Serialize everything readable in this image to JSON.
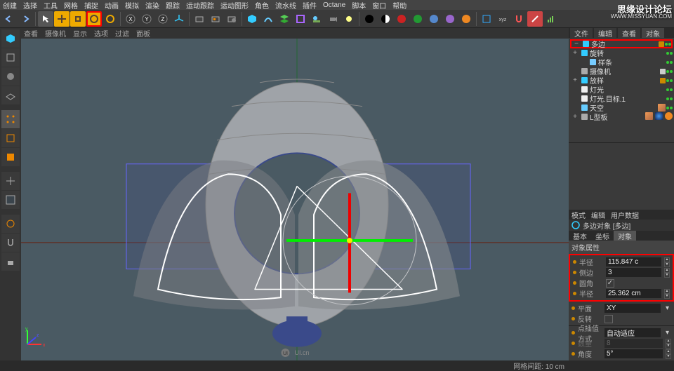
{
  "menu": [
    "创建",
    "选择",
    "工具",
    "网格",
    "捕捉",
    "动画",
    "模拟",
    "渲染",
    "跟踪",
    "运动跟踪",
    "运动图形",
    "角色",
    "流水线",
    "插件",
    "Octane",
    "脚本",
    "窗口",
    "帮助"
  ],
  "viewportMenu": [
    "查看",
    "摄像机",
    "显示",
    "选项",
    "过滤",
    "面板"
  ],
  "watermark": "思缘设计论坛",
  "watermark_url": "WWW.MISSYUAN.COM",
  "objectsPanel": {
    "tabs": [
      "文件",
      "编辑",
      "查看",
      "对象"
    ]
  },
  "tree": [
    {
      "indent": 0,
      "toggle": "−",
      "icon": "poly",
      "color": "#3cf",
      "label": "多边",
      "red": true,
      "tags": [
        "orange",
        "green",
        "green"
      ]
    },
    {
      "indent": 0,
      "toggle": "+",
      "icon": "spin",
      "color": "#3cf",
      "label": "旋转",
      "tags": [
        "green",
        "green"
      ]
    },
    {
      "indent": 1,
      "toggle": "",
      "icon": "spline",
      "color": "#7cf",
      "label": "样条",
      "tags": [
        "green",
        "green"
      ]
    },
    {
      "indent": 0,
      "toggle": "",
      "icon": "camera",
      "color": "#aaa",
      "label": "摄像机",
      "tags": [
        "white",
        "green",
        "green"
      ]
    },
    {
      "indent": 0,
      "toggle": "+",
      "icon": "null",
      "color": "#3cf",
      "label": "放样",
      "tags": [
        "orange",
        "green",
        "green"
      ]
    },
    {
      "indent": 0,
      "toggle": "",
      "icon": "light",
      "color": "#eee",
      "label": "灯光",
      "tags": [
        "green",
        "green"
      ]
    },
    {
      "indent": 0,
      "toggle": "",
      "icon": "light",
      "color": "#eee",
      "label": "灯光.目标.1",
      "tags": [
        "green",
        "green"
      ]
    },
    {
      "indent": 0,
      "toggle": "",
      "icon": "sky",
      "color": "#6cf",
      "label": "天空",
      "tags": [
        "tex",
        "green",
        "green"
      ]
    },
    {
      "indent": 0,
      "toggle": "+",
      "icon": "null",
      "color": "#aaa",
      "label": "L型板",
      "tags": [
        "tex2"
      ]
    }
  ],
  "attrHeader": [
    "模式",
    "编辑",
    "用户数据"
  ],
  "objHeader": {
    "icon": "poly",
    "label": "多边对象 [多边]"
  },
  "attrTabs": [
    "基本",
    "坐标",
    "对象"
  ],
  "attrSection": "对象属性",
  "attrs": [
    {
      "label": "半径",
      "value": "115.847 c",
      "spin": true
    },
    {
      "label": "侧边",
      "value": "3",
      "spin": true
    },
    {
      "label": "圆角",
      "value": "✓",
      "checkbox": true
    },
    {
      "label": "半径",
      "value": "25.362 cm",
      "spin": true
    }
  ],
  "attrs_after": [
    {
      "label": "平面",
      "value": "XY",
      "dropdown": true
    },
    {
      "label": "反转",
      "value": "",
      "checkbox": true
    }
  ],
  "attrs_tail": [
    {
      "label": "点插值方式",
      "value": "自动适应",
      "dropdown": true
    },
    {
      "label": "数量",
      "value": "8",
      "spin": true,
      "dim": true
    },
    {
      "label": "角度",
      "value": "5°",
      "spin": true
    }
  ],
  "status": "网格间距: 10 cm",
  "vp_brand": "UI.cn"
}
